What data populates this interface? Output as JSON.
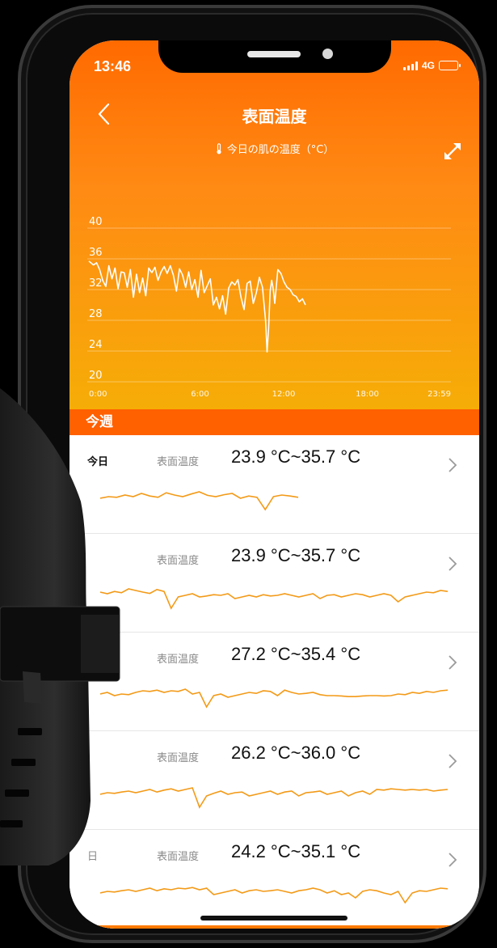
{
  "status": {
    "time": "13:46",
    "network": "4G"
  },
  "header": {
    "title": "表面温度",
    "subtitle": "今日の肌の温度（°C）"
  },
  "chart_data": {
    "type": "line",
    "y_ticks": [
      "40",
      "36",
      "32",
      "28",
      "24",
      "20"
    ],
    "x_ticks": [
      "0:00",
      "6:00",
      "12:00",
      "18:00",
      "23:59"
    ],
    "ylim": [
      20,
      40
    ],
    "series": [
      {
        "color": "#ffffff",
        "x": [
          0.0,
          0.3,
          0.5,
          0.7,
          0.9,
          1.1,
          1.3,
          1.5,
          1.7,
          1.9,
          2.1,
          2.3,
          2.5,
          2.7,
          2.9,
          3.1,
          3.3,
          3.5,
          3.7,
          3.9,
          4.1,
          4.3,
          4.5,
          4.7,
          4.9,
          5.1,
          5.3,
          5.5,
          5.7,
          5.9,
          6.1,
          6.3,
          6.5,
          6.7,
          6.9,
          7.1,
          7.3,
          7.5,
          7.7,
          7.9,
          8.1,
          8.3,
          8.5,
          8.7,
          8.9,
          9.1,
          9.3,
          9.5,
          9.7,
          9.9,
          10.1,
          10.3,
          10.5,
          10.7,
          10.9,
          11.1,
          11.3,
          11.5,
          11.6,
          11.7,
          11.8,
          11.9,
          12.0,
          12.1,
          12.3,
          12.5,
          12.7,
          12.9,
          13.1,
          13.3,
          13.5,
          13.7,
          13.9,
          14.1
        ],
        "y": [
          35.7,
          35.2,
          35.5,
          34.6,
          33.2,
          32.4,
          35.1,
          33.4,
          34.8,
          32.1,
          34.3,
          34.2,
          32.3,
          34.6,
          31.0,
          34.0,
          31.6,
          33.5,
          31.2,
          34.8,
          34.2,
          34.9,
          33.2,
          34.3,
          35.0,
          34.1,
          35.1,
          33.9,
          31.8,
          34.7,
          33.9,
          32.3,
          34.3,
          32.0,
          33.3,
          31.0,
          34.5,
          31.6,
          32.5,
          33.4,
          30.0,
          31.0,
          29.5,
          31.2,
          28.8,
          32.2,
          33.0,
          32.6,
          33.3,
          31.0,
          29.4,
          32.8,
          33.1,
          30.2,
          31.6,
          33.6,
          32.3,
          28.0,
          23.9,
          27.0,
          31.8,
          33.2,
          32.1,
          30.2,
          34.6,
          34.1,
          33.0,
          32.3,
          32.0,
          31.3,
          31.1,
          30.4,
          30.8,
          30.0
        ]
      }
    ]
  },
  "week": {
    "label": "今週"
  },
  "rows": [
    {
      "day": "今日",
      "metric": "表面温度",
      "range": "23.9 °C~35.7 °C"
    },
    {
      "day": "",
      "metric": "表面温度",
      "range": "23.9 °C~35.7 °C"
    },
    {
      "day": "",
      "metric": "表面温度",
      "range": "27.2 °C~35.4 °C"
    },
    {
      "day": "",
      "metric": "表面温度",
      "range": "26.2 °C~36.0 °C"
    },
    {
      "day": "日",
      "metric": "表面温度",
      "range": "24.2 °C~35.1 °C"
    }
  ],
  "sparks": [
    [
      0.55,
      0.5,
      0.52,
      0.45,
      0.5,
      0.4,
      0.48,
      0.52,
      0.38,
      0.45,
      0.5,
      0.42,
      0.35,
      0.46,
      0.5,
      0.44,
      0.4,
      0.55,
      0.48,
      0.52,
      0.9,
      0.5,
      0.45,
      0.48,
      0.52
    ],
    [
      0.4,
      0.45,
      0.38,
      0.42,
      0.3,
      0.35,
      0.4,
      0.44,
      0.32,
      0.38,
      0.9,
      0.55,
      0.5,
      0.45,
      0.55,
      0.52,
      0.48,
      0.5,
      0.45,
      0.6,
      0.55,
      0.5,
      0.55,
      0.48,
      0.52,
      0.5,
      0.45,
      0.5,
      0.55,
      0.5,
      0.45,
      0.6,
      0.5,
      0.48,
      0.55,
      0.5,
      0.45,
      0.48,
      0.55,
      0.5,
      0.45,
      0.5,
      0.7,
      0.55,
      0.5,
      0.45,
      0.4,
      0.42,
      0.35,
      0.38
    ],
    [
      0.5,
      0.45,
      0.55,
      0.5,
      0.52,
      0.45,
      0.4,
      0.42,
      0.38,
      0.45,
      0.4,
      0.42,
      0.35,
      0.5,
      0.45,
      0.9,
      0.55,
      0.5,
      0.6,
      0.55,
      0.5,
      0.45,
      0.48,
      0.4,
      0.42,
      0.55,
      0.38,
      0.45,
      0.5,
      0.48,
      0.45,
      0.52,
      0.55,
      0.55,
      0.56,
      0.58,
      0.58,
      0.56,
      0.55,
      0.55,
      0.56,
      0.55,
      0.5,
      0.52,
      0.45,
      0.48,
      0.42,
      0.45,
      0.4,
      0.38
    ],
    [
      0.55,
      0.5,
      0.52,
      0.48,
      0.45,
      0.5,
      0.45,
      0.4,
      0.48,
      0.42,
      0.38,
      0.45,
      0.4,
      0.35,
      0.95,
      0.6,
      0.52,
      0.45,
      0.55,
      0.5,
      0.48,
      0.6,
      0.55,
      0.5,
      0.45,
      0.55,
      0.48,
      0.45,
      0.6,
      0.5,
      0.48,
      0.45,
      0.55,
      0.5,
      0.45,
      0.6,
      0.5,
      0.45,
      0.55,
      0.4,
      0.42,
      0.38,
      0.4,
      0.42,
      0.4,
      0.42,
      0.4,
      0.45,
      0.42,
      0.4
    ],
    [
      0.55,
      0.5,
      0.52,
      0.48,
      0.45,
      0.5,
      0.45,
      0.4,
      0.48,
      0.42,
      0.45,
      0.4,
      0.42,
      0.38,
      0.45,
      0.4,
      0.6,
      0.55,
      0.5,
      0.45,
      0.55,
      0.48,
      0.45,
      0.5,
      0.48,
      0.45,
      0.5,
      0.55,
      0.48,
      0.45,
      0.4,
      0.45,
      0.55,
      0.48,
      0.6,
      0.55,
      0.7,
      0.5,
      0.45,
      0.48,
      0.55,
      0.6,
      0.5,
      0.85,
      0.55,
      0.48,
      0.5,
      0.45,
      0.4,
      0.42
    ]
  ],
  "colors": {
    "accent": "#ff6000",
    "spark": "#f39a17"
  }
}
